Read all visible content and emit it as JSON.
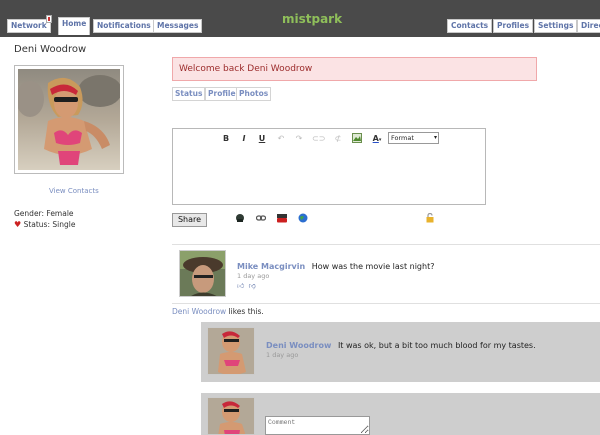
{
  "nav": {
    "left": [
      {
        "label": "Network",
        "name": "nav-network"
      },
      {
        "label": "Home",
        "name": "nav-home"
      },
      {
        "label": "Notifications",
        "name": "nav-notifications"
      },
      {
        "label": "Messages",
        "name": "nav-messages"
      }
    ],
    "site_name": "mistpark",
    "right": [
      {
        "label": "Contacts",
        "name": "nav-contacts"
      },
      {
        "label": "Profiles",
        "name": "nav-profiles"
      },
      {
        "label": "Settings",
        "name": "nav-settings"
      },
      {
        "label": "Direc",
        "name": "nav-directory"
      }
    ]
  },
  "profile": {
    "name": "Deni Woodrow",
    "view_contacts": "View Contacts",
    "gender": "Gender: Female",
    "status": "Status: Single"
  },
  "welcome": "Welcome back Deni Woodrow",
  "tabs": [
    "Status",
    "Profile",
    "Photos"
  ],
  "editor": {
    "format_label": "Format",
    "share_label": "Share"
  },
  "posts": [
    {
      "author": "Mike Macgirvin",
      "message": "How was the movie last night?",
      "ago": "1 day ago"
    }
  ],
  "likes": {
    "who": "Deni Woodrow",
    "text": " likes this."
  },
  "comments": [
    {
      "author": "Deni Woodrow",
      "message": "It was ok, but a bit too much blood for my tastes.",
      "ago": "1 day ago"
    }
  ],
  "comment_placeholder": "Comment",
  "colors": {
    "topbar": "#4a4a4a",
    "link": "#7a8ec0",
    "site_name": "#8fbf5a",
    "welcome_bg": "#fbe3e4",
    "comment_bg": "#cecece"
  }
}
